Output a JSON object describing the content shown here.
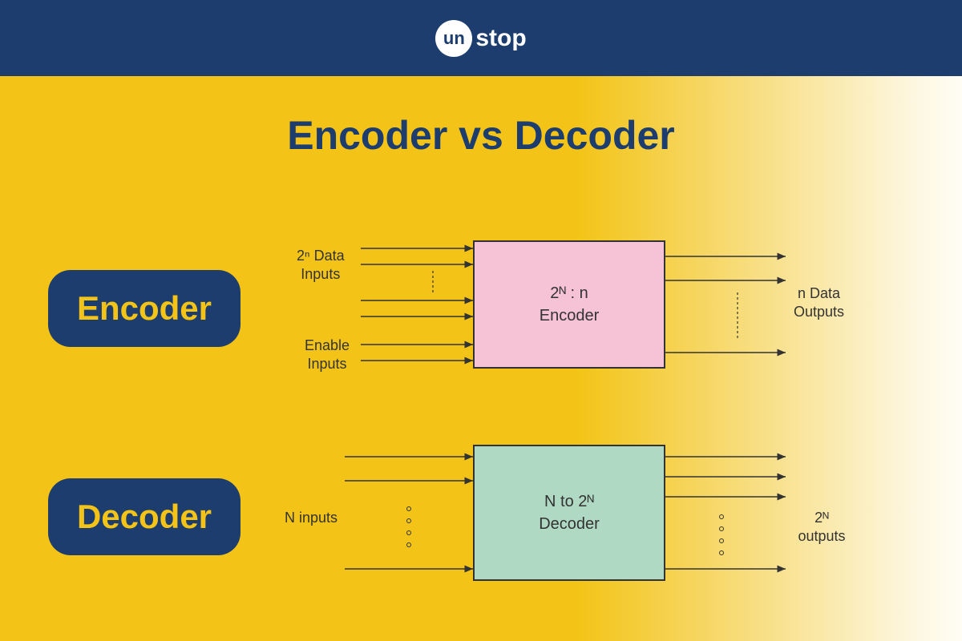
{
  "brand": {
    "circle": "un",
    "rest": "stop"
  },
  "title": "Encoder vs Decoder",
  "encoder": {
    "pill": "Encoder",
    "block_line1": "2ᴺ : n",
    "block_line2": "Encoder",
    "input_label_line1": "2ⁿ Data",
    "input_label_line2": "Inputs",
    "enable_label_line1": "Enable",
    "enable_label_line2": "Inputs",
    "output_label_line1": "n Data",
    "output_label_line2": "Outputs"
  },
  "decoder": {
    "pill": "Decoder",
    "block_line1": "N to 2ᴺ",
    "block_line2": "Decoder",
    "input_label": "N inputs",
    "output_label": "2ᴺ outputs"
  },
  "colors": {
    "navy": "#1c3d6e",
    "yellow": "#f3c417",
    "pink": "#f6c2d5",
    "green": "#b0d9c3"
  }
}
